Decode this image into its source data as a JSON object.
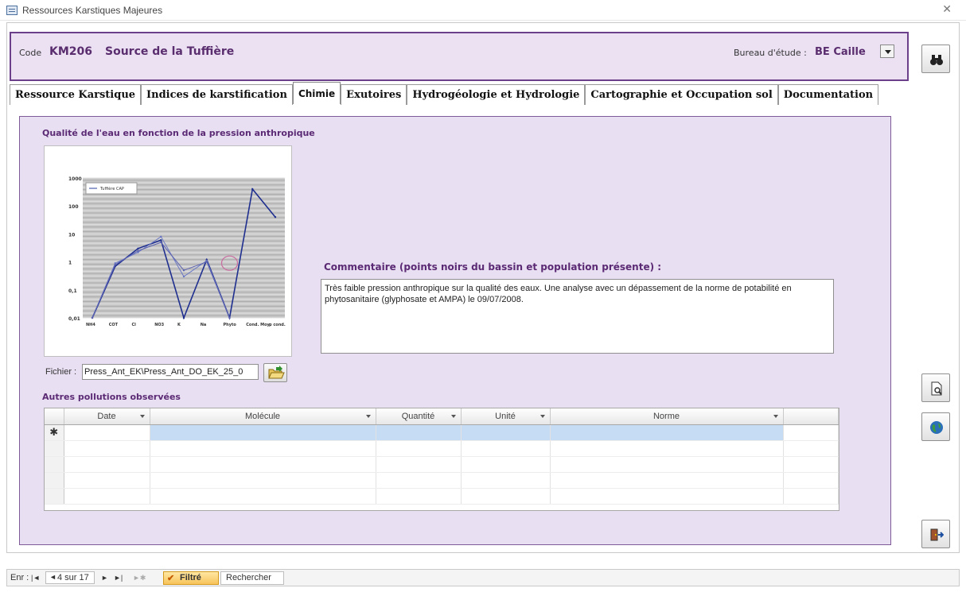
{
  "window": {
    "title": "Ressources Karstiques Majeures",
    "close_glyph": "✕"
  },
  "header": {
    "code_label": "Code",
    "code_value": "KM206",
    "name_value": "Source de la Tuffière",
    "bureau_label": "Bureau d'étude :",
    "bureau_value": "BE Caille"
  },
  "tabs": [
    {
      "label": "Ressource Karstique",
      "active": false
    },
    {
      "label": "Indices de karstification",
      "active": false
    },
    {
      "label": "Chimie",
      "active": true
    },
    {
      "label": "Exutoires",
      "active": false
    },
    {
      "label": "Hydrogéologie et  Hydrologie",
      "active": false
    },
    {
      "label": "Cartographie et Occupation sol",
      "active": false
    },
    {
      "label": "Documentation",
      "active": false
    }
  ],
  "chimie": {
    "chart_title": "Qualité de l'eau en fonction de la pression anthropique",
    "comment_title": "Commentaire (points noirs du bassin et population présente) :",
    "comment_text": "Très faible pression anthropique sur la qualité des eaux. Une analyse avec un dépassement de la norme de potabilité  en phytosanitaire (glyphosate et AMPA) le 09/07/2008.",
    "fichier_label": "Fichier :",
    "fichier_value": "Press_Ant_EK\\Press_Ant_DO_EK_25_0",
    "autres_title": "Autres pollutions observées",
    "grid_columns": [
      "Date",
      "Molécule",
      "Quantité",
      "Unité",
      "Norme"
    ],
    "new_row_marker": "✱"
  },
  "chart_data": {
    "type": "line",
    "y_scale": "log",
    "ylim": [
      0.01,
      1000
    ],
    "y_ticks": [
      "1000",
      "100",
      "10",
      "1",
      "0,1",
      "0,01"
    ],
    "categories": [
      "NH4",
      "COT",
      "Cl",
      "NO3",
      "K",
      "Na",
      "Phyto",
      "Cond. Moy.",
      "p cond."
    ],
    "legend": "Tuffière CAP",
    "series": [
      {
        "name": "Tuffière CAP",
        "values": [
          0.01,
          0.7,
          3,
          6,
          0.01,
          1.2,
          0.01,
          400,
          40
        ]
      },
      {
        "name": "",
        "values": [
          0.01,
          0.9,
          2.2,
          8,
          0.3,
          1.1,
          0.01,
          null,
          null
        ]
      },
      {
        "name": "",
        "values": [
          0.01,
          0.8,
          2.5,
          5,
          0.5,
          1.0,
          0.01,
          null,
          null
        ]
      }
    ],
    "colors": {
      "line": "#2b3f9b",
      "highlight": "#c86b9e",
      "grid_bg": "#c8c8c8"
    }
  },
  "statusbar": {
    "record_label": "Enr :",
    "record_value": "4 sur 17",
    "filter_label": "Filtré",
    "search_label": "Rechercher",
    "nav_first": "|◄",
    "nav_prev": "◄",
    "nav_next": "►",
    "nav_last": "►|",
    "nav_new": "►✱"
  }
}
